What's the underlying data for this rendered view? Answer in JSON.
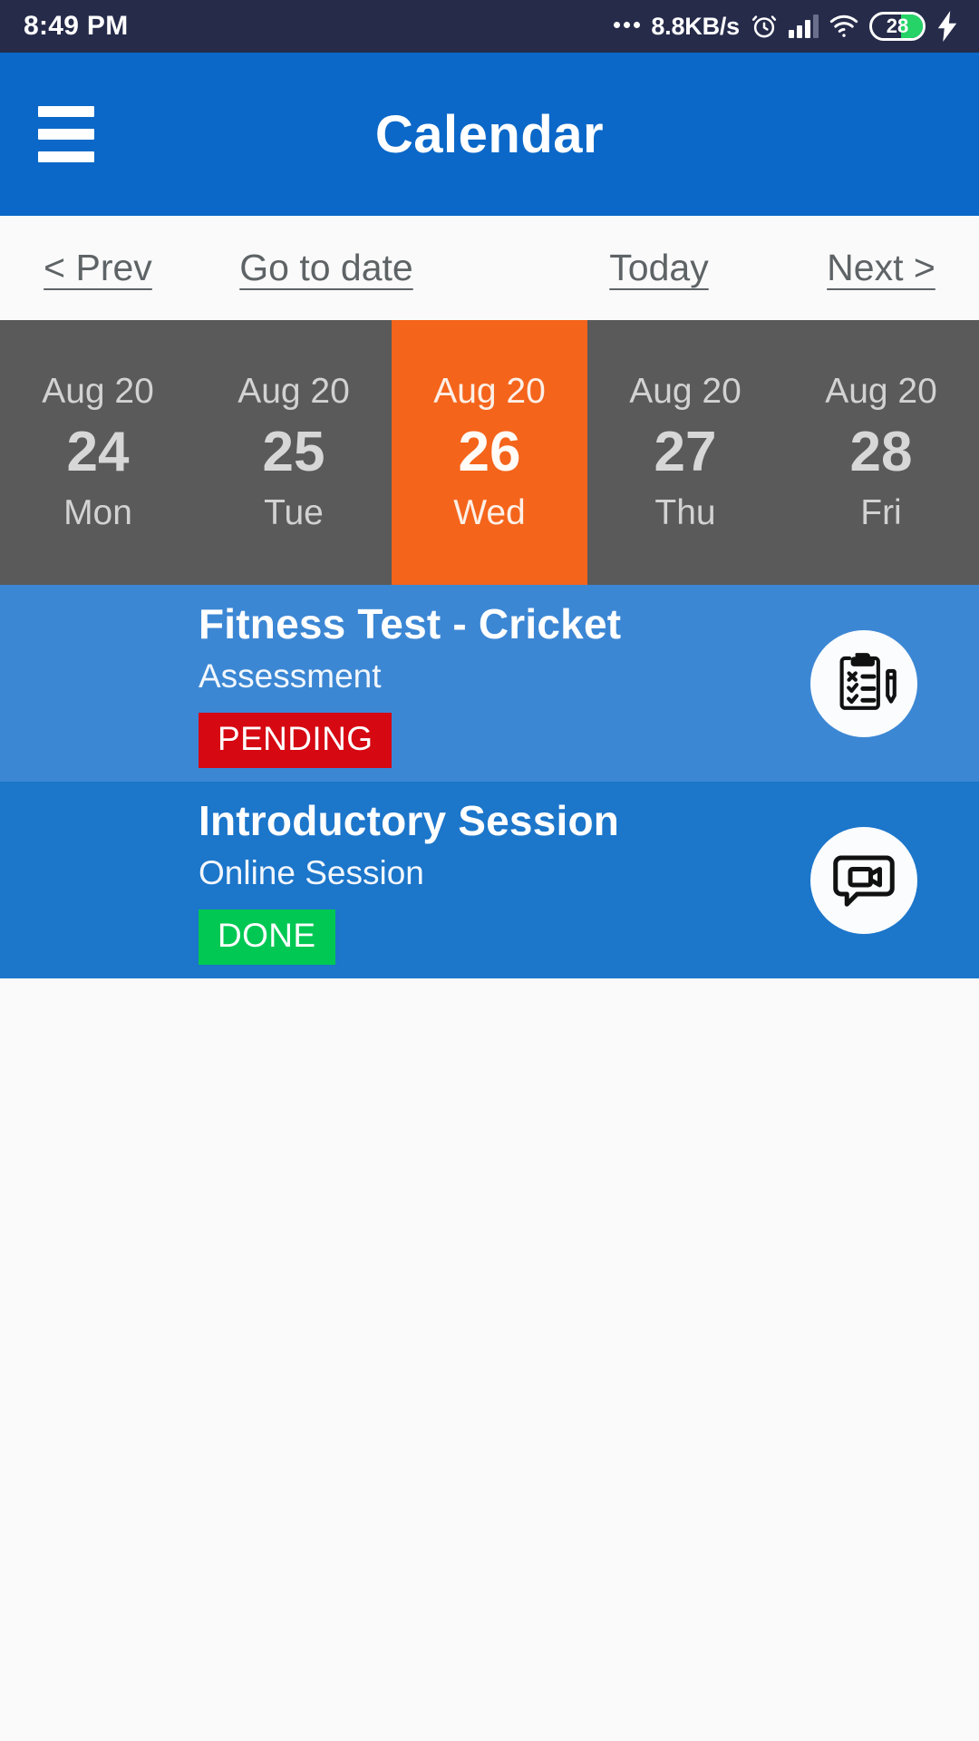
{
  "status_bar": {
    "time": "8:49 PM",
    "network_speed": "8.8KB/s",
    "battery_level": "28",
    "icons": [
      "ellipsis-icon",
      "alarm-clock-icon",
      "signal-bars-icon",
      "wifi-icon",
      "battery-icon",
      "charging-bolt-icon"
    ],
    "colors": {
      "background": "#262B4A",
      "battery_fill": "#25D366"
    }
  },
  "app_bar": {
    "title": "Calendar",
    "menu_icon": "hamburger-menu-icon",
    "color": "#0B68C8"
  },
  "nav": {
    "prev": "< Prev",
    "goto_date": "Go to date",
    "today": "Today",
    "next": "Next >"
  },
  "date_strip": {
    "selected_index": 2,
    "selected_color": "#F4641B",
    "unselected_color": "#5A5A5A",
    "days": [
      {
        "month": "Aug 20",
        "day": "24",
        "dow": "Mon",
        "selected": false
      },
      {
        "month": "Aug 20",
        "day": "25",
        "dow": "Tue",
        "selected": false
      },
      {
        "month": "Aug 20",
        "day": "26",
        "dow": "Wed",
        "selected": true
      },
      {
        "month": "Aug 20",
        "day": "27",
        "dow": "Thu",
        "selected": false
      },
      {
        "month": "Aug 20",
        "day": "28",
        "dow": "Fri",
        "selected": false
      }
    ]
  },
  "events": [
    {
      "title": "Fitness Test - Cricket",
      "subtitle": "Assessment",
      "status": "PENDING",
      "status_color": "#D60812",
      "card_color": "#3C87D4",
      "icon": "clipboard-checklist-icon"
    },
    {
      "title": "Introductory Session",
      "subtitle": "Online Session",
      "status": "DONE",
      "status_color": "#00C853",
      "card_color": "#1C76CA",
      "icon": "video-chat-icon"
    }
  ]
}
